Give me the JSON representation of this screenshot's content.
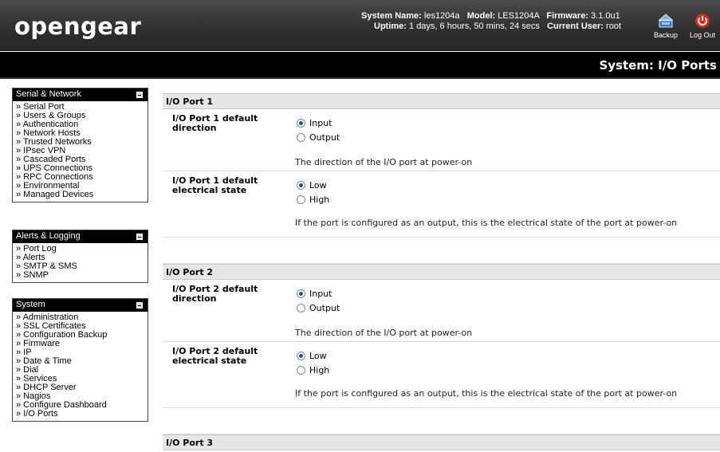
{
  "header": {
    "logo": "opengear",
    "system_name_label": "System Name:",
    "system_name": "les1204a",
    "model_label": "Model:",
    "model": "LES1204A",
    "firmware_label": "Firmware:",
    "firmware": "3.1.0u1",
    "uptime_label": "Uptime:",
    "uptime": "1 days, 6 hours, 50 mins, 24 secs",
    "current_user_label": "Current User:",
    "current_user": "root",
    "backup_label": "Backup",
    "logout_label": "Log Out"
  },
  "page_title": "System: I/O Ports",
  "sidebar": {
    "serial_network": {
      "title": "Serial & Network",
      "items": [
        "» Serial Port",
        "» Users & Groups",
        "» Authentication",
        "» Network Hosts",
        "» Trusted Networks",
        "» IPsec VPN",
        "» Cascaded Ports",
        "» UPS Connections",
        "» RPC Connections",
        "» Environmental",
        "» Managed Devices"
      ]
    },
    "alerts_logging": {
      "title": "Alerts & Logging",
      "items": [
        "» Port Log",
        "» Alerts",
        "» SMTP & SMS",
        "» SNMP"
      ]
    },
    "system": {
      "title": "System",
      "items": [
        "» Administration",
        "» SSL Certificates",
        "» Configuration Backup",
        "» Firmware",
        "» IP",
        "» Date & Time",
        "» Dial",
        "» Services",
        "» DHCP Server",
        "» Nagios",
        "» Configure Dashboard",
        "» I/O Ports"
      ]
    }
  },
  "ports": [
    {
      "title": "I/O Port 1",
      "direction_label": "I/O Port 1 default direction",
      "direction_options": [
        "Input",
        "Output"
      ],
      "direction_selected": "Input",
      "direction_help": "The direction of the I/O port at power-on",
      "state_label": "I/O Port 1 default electrical state",
      "state_options": [
        "Low",
        "High"
      ],
      "state_selected": "Low",
      "state_help": "If the port is configured as an output, this is the electrical state of the port at power-on"
    },
    {
      "title": "I/O Port 2",
      "direction_label": "I/O Port 2 default direction",
      "direction_options": [
        "Input",
        "Output"
      ],
      "direction_selected": "Input",
      "direction_help": "The direction of the I/O port at power-on",
      "state_label": "I/O Port 2 default electrical state",
      "state_options": [
        "Low",
        "High"
      ],
      "state_selected": "Low",
      "state_help": "If the port is configured as an output, this is the electrical state of the port at power-on"
    },
    {
      "title": "I/O Port 3"
    }
  ],
  "colors": {
    "header_bg": "#2e2e2e",
    "titlebar_bg": "#000000",
    "section_header_bg": "#e6e6e6",
    "logout_red": "#d9261c",
    "radio_selected": "#1a4fa0"
  },
  "icons": {
    "backup": "backup-icon",
    "logout": "power-icon",
    "collapse": "minimize-icon"
  }
}
